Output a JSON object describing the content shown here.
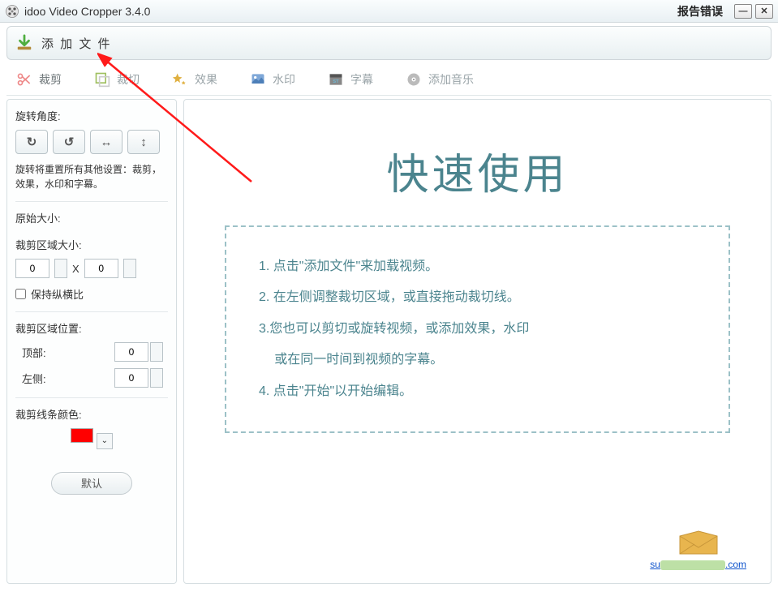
{
  "titlebar": {
    "title": "idoo Video Cropper 3.4.0",
    "report": "报告错误"
  },
  "fileadd": {
    "label": "添 加 文 件"
  },
  "tabs": {
    "crop": "裁剪",
    "cut": "裁切",
    "effect": "效果",
    "watermark": "水印",
    "subtitle": "字幕",
    "music": "添加音乐"
  },
  "side": {
    "rotate_title": "旋转角度:",
    "rotate_note": "旋转将重置所有其他设置：裁剪，效果，水印和字幕。",
    "orig_size": "原始大小:",
    "crop_area_size": "裁剪区域大小:",
    "width": "0",
    "height": "0",
    "keep_ratio": "保持纵横比",
    "crop_pos": "裁剪区域位置:",
    "top": "顶部:",
    "top_val": "0",
    "left": "左侧:",
    "left_val": "0",
    "line_color": "裁剪线条颜色:",
    "default_btn": "默认"
  },
  "main": {
    "hero": "快速使用",
    "step1": "1. 点击\"添加文件\"来加载视频。",
    "step2": "2. 在左侧调整裁切区域，或直接拖动裁切线。",
    "step3a": "3.您也可以剪切或旋转视频，或添加效果，水印",
    "step3b": "或在同一时间到视频的字幕。",
    "step4": "4. 点击\"开始\"以开始编辑。",
    "mail_prefix": "su",
    "mail_suffix": ".com"
  }
}
